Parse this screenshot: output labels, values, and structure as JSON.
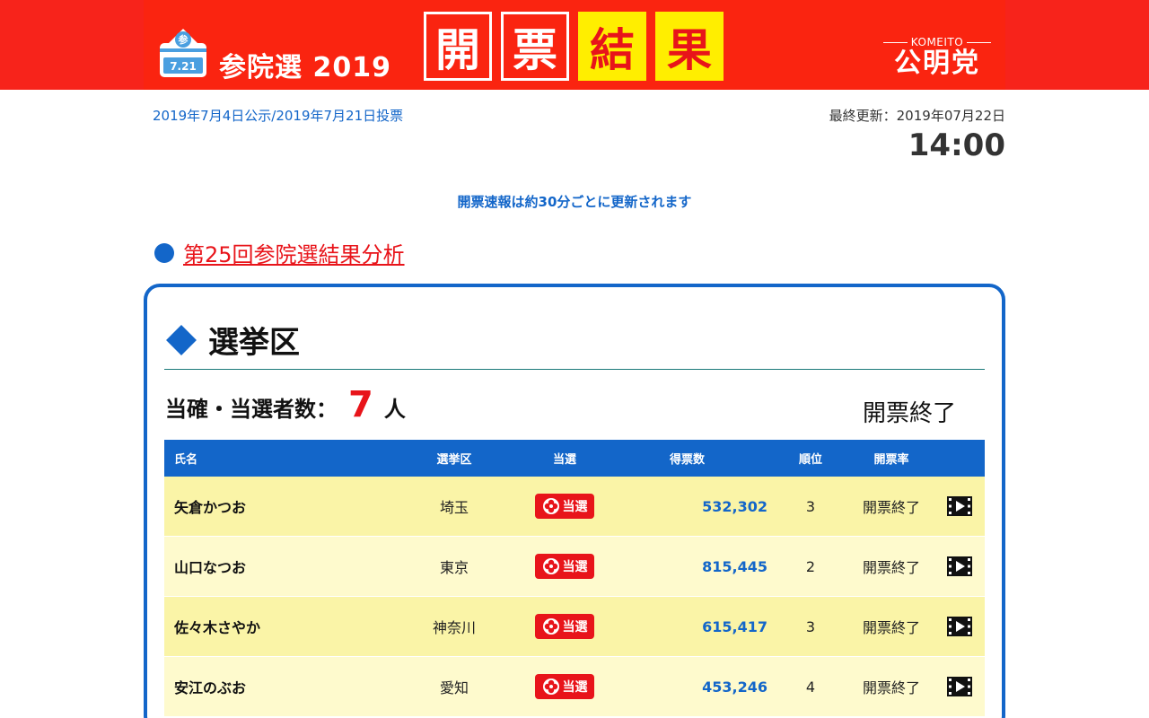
{
  "header": {
    "ballot_label": "参",
    "ballot_date": "7.21",
    "election_title": "参院選 2019",
    "result_chars": [
      "開",
      "票",
      "結",
      "果"
    ],
    "party_sub": "KOMEITO",
    "party_name": "公明党",
    "colors": {
      "bg": "#f7231b",
      "highlight": "#ffee00",
      "text_red": "#e8141a"
    }
  },
  "info": {
    "dates": "2019年7月4日公示/2019年7月21日投票",
    "updated_label": "最終更新：2019年07月22日",
    "updated_time": "14:00",
    "notice": "開票速報は約30分ごとに更新されます"
  },
  "analysis": {
    "link_text": "第25回参院選結果分析"
  },
  "section": {
    "title": "選挙区",
    "winner_label": "当確・当選者数：",
    "winner_count": "7",
    "winner_unit": "人",
    "count_status": "開票終了"
  },
  "table": {
    "headers": {
      "name": "氏名",
      "district": "選挙区",
      "elected": "当選",
      "votes": "得票数",
      "rank": "順位",
      "rate": "開票率"
    },
    "rows": [
      {
        "name": "矢倉かつお",
        "district": "埼玉",
        "elected": "当選",
        "votes": "532,302",
        "rank": "3",
        "rate": "開票終了",
        "video_icon": "video-icon"
      },
      {
        "name": "山口なつお",
        "district": "東京",
        "elected": "当選",
        "votes": "815,445",
        "rank": "2",
        "rate": "開票終了",
        "video_icon": "video-icon"
      },
      {
        "name": "佐々木さやか",
        "district": "神奈川",
        "elected": "当選",
        "votes": "615,417",
        "rank": "3",
        "rate": "開票終了",
        "video_icon": "video-icon"
      },
      {
        "name": "安江のぶお",
        "district": "愛知",
        "elected": "当選",
        "votes": "453,246",
        "rank": "4",
        "rate": "開票終了",
        "video_icon": "video-icon"
      }
    ],
    "colors": {
      "header_bg": "#1366c9",
      "row_odd": "#faf4a7",
      "row_even": "#fefacd",
      "votes": "#1366c9",
      "badge": "#e8141a"
    }
  }
}
